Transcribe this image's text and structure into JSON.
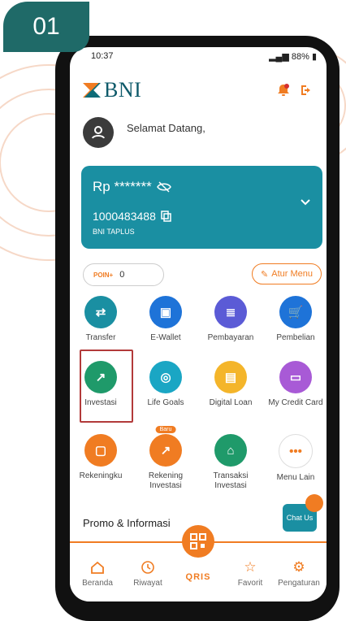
{
  "step": "01",
  "status": {
    "time": "10:37",
    "battery": "88%"
  },
  "brand": "BNI",
  "greeting": "Selamat Datang,",
  "balance": {
    "amount": "Rp *******",
    "account": "1000483488",
    "type": "BNI TAPLUS"
  },
  "poin": {
    "logo": "POIN+",
    "value": "0"
  },
  "atur_menu": "Atur Menu",
  "menu": [
    {
      "label": "Transfer",
      "icon": "transfer-icon",
      "color": "#1a8fa2"
    },
    {
      "label": "E-Wallet",
      "icon": "wallet-icon",
      "color": "#1e73d8"
    },
    {
      "label": "Pembayaran",
      "icon": "bill-icon",
      "color": "#5b5bd6"
    },
    {
      "label": "Pembelian",
      "icon": "cart-icon",
      "color": "#1e73d8"
    },
    {
      "label": "Investasi",
      "icon": "investment-icon",
      "color": "#1f9a6a"
    },
    {
      "label": "Life Goals",
      "icon": "goals-icon",
      "color": "#1aa6c4"
    },
    {
      "label": "Digital Loan",
      "icon": "loan-icon",
      "color": "#f4b52a"
    },
    {
      "label": "My Credit Card",
      "icon": "credit-card-icon",
      "color": "#a85ad6"
    },
    {
      "label": "Rekeningku",
      "icon": "account-icon",
      "color": "#f07c22"
    },
    {
      "label": "Rekening Investasi",
      "icon": "investment-account-icon",
      "color": "#f07c22",
      "badge": "Baru"
    },
    {
      "label": "Transaksi Investasi",
      "icon": "basket-icon",
      "color": "#1f9a6a"
    },
    {
      "label": "Menu Lain",
      "icon": "more-icon",
      "color": "#ffffff"
    }
  ],
  "chat": "Chat Us",
  "promo_title": "Promo & Informasi",
  "tabs": [
    {
      "label": "Beranda",
      "icon": "home-icon"
    },
    {
      "label": "Riwayat",
      "icon": "history-icon"
    },
    {
      "label": "QRIS",
      "icon": "qr-icon"
    },
    {
      "label": "Favorit",
      "icon": "star-icon"
    },
    {
      "label": "Pengaturan",
      "icon": "gear-icon"
    }
  ]
}
